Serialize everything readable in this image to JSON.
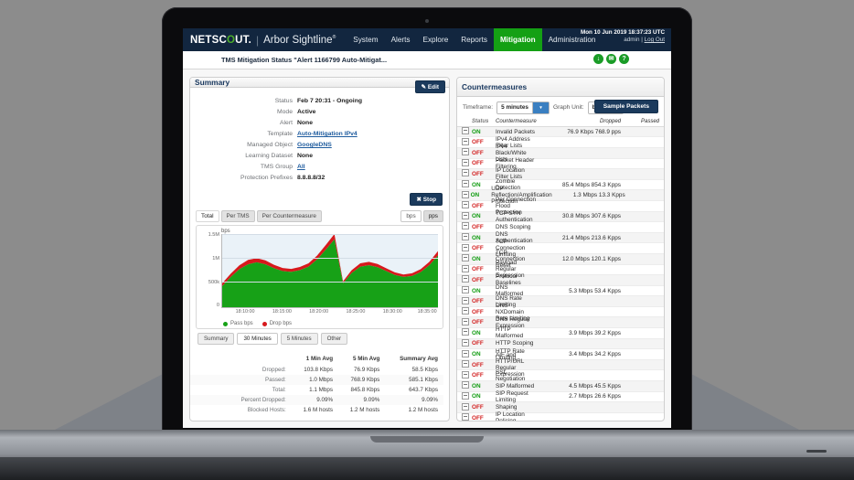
{
  "nav": {
    "brand_primary": "NETSCOUT.",
    "brand_sep": "|",
    "brand_secondary": "Arbor Sightline",
    "items": [
      {
        "label": "System",
        "active": false
      },
      {
        "label": "Alerts",
        "active": false
      },
      {
        "label": "Explore",
        "active": false
      },
      {
        "label": "Reports",
        "active": false
      },
      {
        "label": "Mitigation",
        "active": true
      },
      {
        "label": "Administration",
        "active": false
      }
    ],
    "timestamp": "Mon 10 Jun 2019 18:37:23 UTC",
    "user": "admin",
    "user_sep": "|",
    "logout": "Log Out",
    "accent_green": "#14a014",
    "navy": "#12263f"
  },
  "subbar": {
    "breadcrumb": "TMS Mitigation Status \"Alert 1166799 Auto-Mitigat...",
    "icons": [
      {
        "name": "download-icon",
        "glyph": "↓"
      },
      {
        "name": "message-icon",
        "glyph": "✉"
      },
      {
        "name": "help-icon",
        "glyph": "?"
      }
    ]
  },
  "summary": {
    "title": "Summary",
    "edit_label": "Edit",
    "stop_label": "Stop",
    "fields": [
      {
        "label": "Status",
        "value": "Feb 7 20:31 - Ongoing",
        "link": false
      },
      {
        "label": "Mode",
        "value": "Active",
        "link": false
      },
      {
        "label": "Alert",
        "value": "None",
        "link": false
      },
      {
        "label": "Template",
        "value": "Auto-Mitigation IPv4",
        "link": true
      },
      {
        "label": "Managed Object",
        "value": "GoogleDNS",
        "link": true
      },
      {
        "label": "Learning Dataset",
        "value": "None",
        "link": false
      },
      {
        "label": "TMS Group",
        "value": "All",
        "link": true
      },
      {
        "label": "Protection Prefixes",
        "value": "8.8.8.8/32",
        "link": false
      }
    ]
  },
  "chart_controls": {
    "tabs": [
      {
        "label": "Total",
        "active": true
      },
      {
        "label": "Per TMS",
        "active": false
      },
      {
        "label": "Per Countermeasure",
        "active": false
      }
    ],
    "units": [
      {
        "label": "bps",
        "active": false
      },
      {
        "label": "pps",
        "active": true
      }
    ],
    "ranges": [
      {
        "label": "Summary",
        "active": false
      },
      {
        "label": "30 Minutes",
        "active": true
      },
      {
        "label": "5 Minutes",
        "active": false
      },
      {
        "label": "Other",
        "active": false
      }
    ]
  },
  "chart_data": {
    "type": "area",
    "title": "bps",
    "xlabel": "",
    "ylabel": "bps",
    "ylim": [
      0,
      1500000
    ],
    "ytick_labels": [
      "1.5M",
      "1M",
      "500k",
      "0"
    ],
    "ytick_values": [
      1500000,
      1000000,
      500000,
      0
    ],
    "xtick_labels": [
      "18:10:00",
      "18:15:00",
      "18:20:00",
      "18:25:00",
      "18:30:00",
      "18:35:00"
    ],
    "grid": true,
    "legend_position": "bottom-left",
    "series": [
      {
        "name": "Pass bps",
        "color": "#17a117",
        "values": [
          430000,
          620000,
          780000,
          880000,
          920000,
          880000,
          800000,
          740000,
          725000,
          760000,
          830000,
          980000,
          1180000,
          1390000,
          490000,
          700000,
          830000,
          860000,
          820000,
          740000,
          660000,
          620000,
          640000,
          720000,
          860000,
          1060000
        ]
      },
      {
        "name": "Drop bps",
        "color": "#d7191c",
        "values": [
          60000,
          70000,
          80000,
          90000,
          85000,
          80000,
          70000,
          65000,
          60000,
          65000,
          70000,
          80000,
          95000,
          110000,
          40000,
          60000,
          70000,
          70000,
          65000,
          60000,
          55000,
          50000,
          55000,
          60000,
          70000,
          90000
        ]
      }
    ]
  },
  "stats": {
    "columns": [
      "",
      "1 Min Avg",
      "5 Min Avg",
      "Summary Avg"
    ],
    "rows": [
      {
        "label": "Dropped:",
        "values": [
          "103.8 Kbps",
          "76.9 Kbps",
          "58.5 Kbps"
        ]
      },
      {
        "label": "Passed:",
        "values": [
          "1.0 Mbps",
          "768.9 Kbps",
          "585.1 Kbps"
        ]
      },
      {
        "label": "Total:",
        "values": [
          "1.1 Mbps",
          "845.8 Kbps",
          "643.7 Kbps"
        ]
      },
      {
        "label": "Percent Dropped:",
        "values": [
          "9.09%",
          "9.09%",
          "9.09%"
        ]
      },
      {
        "label": "Blocked Hosts:",
        "values": [
          "1.6 M hosts",
          "1.2 M hosts",
          "1.2 M hosts"
        ]
      }
    ]
  },
  "countermeasures": {
    "title": "Countermeasures",
    "timeframe_label": "Timeframe:",
    "timeframe_value": "5 minutes",
    "graphunit_label": "Graph Unit:",
    "graphunit_value": "bps",
    "sample_label": "Sample Packets",
    "columns": {
      "status": "Status",
      "name": "Countermeasure",
      "dropped": "Dropped",
      "passed": "Passed"
    },
    "rows": [
      {
        "status": "ON",
        "name": "Invalid Packets",
        "dropped": "76.9 Kbps 768.9 pps",
        "passed": ""
      },
      {
        "status": "OFF",
        "name": "IPv4 Address Filter Lists",
        "dropped": "",
        "passed": ""
      },
      {
        "status": "OFF",
        "name": "IPv4 Black/White Lists",
        "dropped": "",
        "passed": ""
      },
      {
        "status": "OFF",
        "name": "Packet Header Filtering",
        "dropped": "",
        "passed": ""
      },
      {
        "status": "OFF",
        "name": "IP Location Filter Lists",
        "dropped": "",
        "passed": ""
      },
      {
        "status": "ON",
        "name": "Zombie Detection",
        "dropped": "85.4 Mbps 854.3 Kpps",
        "passed": ""
      },
      {
        "status": "ON",
        "name": "UDP Reflection/Amplification Protection",
        "dropped": "1.3 Mbps 13.3 Kpps",
        "passed": ""
      },
      {
        "status": "OFF",
        "name": "Per Connection Flood Protection",
        "dropped": "",
        "passed": ""
      },
      {
        "status": "ON",
        "name": "TCP SYN Authentication",
        "dropped": "30.8 Mbps 307.6 Kpps",
        "passed": ""
      },
      {
        "status": "OFF",
        "name": "DNS Scoping",
        "dropped": "",
        "passed": ""
      },
      {
        "status": "ON",
        "name": "DNS Authentication",
        "dropped": "21.4 Mbps 213.6 Kpps",
        "passed": ""
      },
      {
        "status": "OFF",
        "name": "TCP Connection Limiting",
        "dropped": "",
        "passed": ""
      },
      {
        "status": "ON",
        "name": "TCP Connection Reset",
        "dropped": "12.0 Mbps 120.1 Kpps",
        "passed": ""
      },
      {
        "status": "OFF",
        "name": "Payload Regular Expression",
        "dropped": "",
        "passed": ""
      },
      {
        "status": "OFF",
        "name": "Protocol Baselines",
        "dropped": "",
        "passed": ""
      },
      {
        "status": "ON",
        "name": "DNS Malformed",
        "dropped": "5.3 Mbps 53.4 Kpps",
        "passed": ""
      },
      {
        "status": "OFF",
        "name": "DNS Rate Limiting",
        "dropped": "",
        "passed": ""
      },
      {
        "status": "OFF",
        "name": "DNS NXDomain Rate Limiting",
        "dropped": "",
        "passed": ""
      },
      {
        "status": "OFF",
        "name": "DNS Regular Expression",
        "dropped": "",
        "passed": ""
      },
      {
        "status": "ON",
        "name": "HTTP Malformed",
        "dropped": "3.9 Mbps 39.2 Kpps",
        "passed": ""
      },
      {
        "status": "OFF",
        "name": "HTTP Scoping",
        "dropped": "",
        "passed": ""
      },
      {
        "status": "ON",
        "name": "HTTP Rate Limiting",
        "dropped": "3.4 Mbps 34.2 Kpps",
        "passed": ""
      },
      {
        "status": "OFF",
        "name": "AIF and HTTP/URL Regular Expression",
        "dropped": "",
        "passed": ""
      },
      {
        "status": "OFF",
        "name": "SSL Negotiation",
        "dropped": "",
        "passed": ""
      },
      {
        "status": "ON",
        "name": "SIP Malformed",
        "dropped": "4.5 Mbps 45.5 Kpps",
        "passed": ""
      },
      {
        "status": "ON",
        "name": "SIP Request Limiting",
        "dropped": "2.7 Mbps 26.6 Kpps",
        "passed": ""
      },
      {
        "status": "OFF",
        "name": "Shaping",
        "dropped": "",
        "passed": ""
      },
      {
        "status": "OFF",
        "name": "IP Location Policing",
        "dropped": "",
        "passed": ""
      }
    ]
  }
}
